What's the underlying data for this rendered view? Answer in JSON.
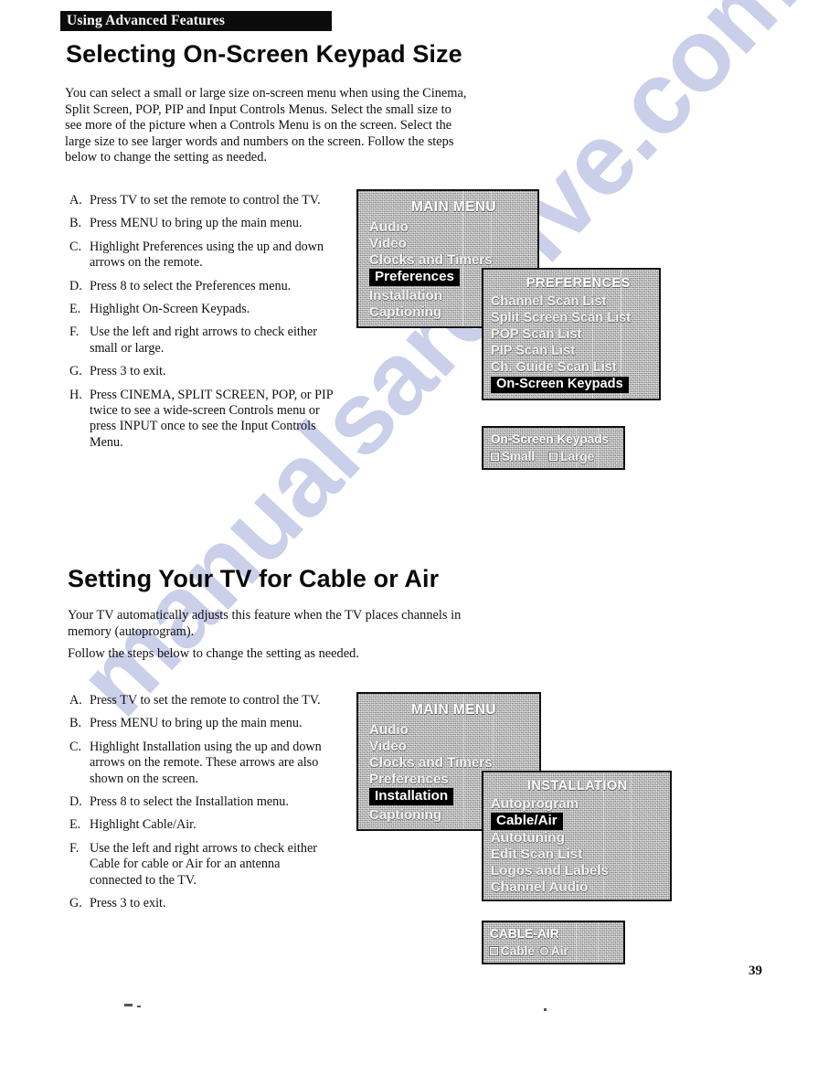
{
  "running_head": "Using Advanced Features",
  "page_number": "39",
  "watermark": "manualsarchive.com",
  "colors": {
    "ink": "#111111",
    "header_bar": "#0b0b0b",
    "highlight_bar": "#000000",
    "menu_screen": "#b8b8b8",
    "watermark": "#b9bfe4"
  },
  "sections": [
    {
      "title": "Selecting On-Screen Keypad Size",
      "intro": "You can select a small or large size on-screen menu when using the Cinema, Split Screen, POP, PIP and Input Controls Menus.  Select the small size to see more of the picture when a Controls Menu is on the screen.  Select the large size to see larger words and numbers on the screen.  Follow the steps below to change the setting as needed.",
      "steps": [
        {
          "letter": "A.",
          "text": "Press TV to set the remote to control the TV."
        },
        {
          "letter": "B.",
          "text": "Press MENU to bring up the main menu."
        },
        {
          "letter": "C.",
          "text": "Highlight Preferences using the up and down arrows on the remote."
        },
        {
          "letter": "D.",
          "text": "Press 8 to select the Preferences menu."
        },
        {
          "letter": "E.",
          "text": "Highlight On-Screen Keypads."
        },
        {
          "letter": "F.",
          "text": "Use the left and right arrows to check either small or large."
        },
        {
          "letter": "G.",
          "text": "Press 3 to exit."
        },
        {
          "letter": "H.",
          "text": "Press CINEMA, SPLIT SCREEN, POP, or PIP twice to see a wide-screen Controls menu or press INPUT once to see the Input Controls Menu."
        }
      ]
    },
    {
      "title": "Setting Your TV for Cable or Air",
      "intro_a": "Your TV automatically adjusts this feature when the TV places channels in memory (autoprogram).",
      "intro_b": "Follow the steps below to change the setting as needed.",
      "steps": [
        {
          "letter": "A.",
          "text": "Press TV to set the remote to control the TV."
        },
        {
          "letter": "B.",
          "text": "Press MENU to bring up the main menu."
        },
        {
          "letter": "C.",
          "text": "Highlight Installation using the up and down arrows on the remote.  These arrows are also shown on the screen."
        },
        {
          "letter": "D.",
          "text": "Press 8 to select the Installation menu."
        },
        {
          "letter": "E.",
          "text": "Highlight Cable/Air."
        },
        {
          "letter": "F.",
          "text": "Use the left and right arrows to check either Cable for cable or Air for an antenna connected to the TV."
        },
        {
          "letter": "G.",
          "text": "Press 3 to exit."
        }
      ]
    }
  ],
  "menus": {
    "main_menu_preferences": {
      "title": "MAIN MENU",
      "items": [
        {
          "label": "Audio",
          "highlighted": false
        },
        {
          "label": "Video",
          "highlighted": false
        },
        {
          "label": "Clocks and Timers",
          "highlighted": false
        },
        {
          "label": "Preferences",
          "highlighted": true
        },
        {
          "label": "Installation",
          "highlighted": false
        },
        {
          "label": "Captioning",
          "highlighted": false
        }
      ]
    },
    "preferences": {
      "title": "PREFERENCES",
      "items": [
        {
          "label": "Channel Scan List",
          "highlighted": false
        },
        {
          "label": "Split Screen Scan List",
          "highlighted": false
        },
        {
          "label": "POP Scan List",
          "highlighted": false
        },
        {
          "label": "PIP Scan List",
          "highlighted": false
        },
        {
          "label": "Ch. Guide Scan List",
          "highlighted": false
        },
        {
          "label": "On-Screen Keypads",
          "highlighted": true
        }
      ]
    },
    "on_screen_keypads_dialog": {
      "title": "On-Screen Keypads",
      "options": [
        {
          "label": "Small",
          "marker": "box"
        },
        {
          "label": "Large",
          "marker": "box"
        }
      ]
    },
    "main_menu_installation": {
      "title": "MAIN MENU",
      "items": [
        {
          "label": "Audio",
          "highlighted": false
        },
        {
          "label": "Video",
          "highlighted": false
        },
        {
          "label": "Clocks and Timers",
          "highlighted": false
        },
        {
          "label": "Preferences",
          "highlighted": false
        },
        {
          "label": "Installation",
          "highlighted": true
        },
        {
          "label": "Captioning",
          "highlighted": false
        }
      ]
    },
    "installation": {
      "title": "INSTALLATION",
      "items": [
        {
          "label": "Autoprogram",
          "highlighted": false
        },
        {
          "label": "Cable/Air",
          "highlighted": true
        },
        {
          "label": "Autotuning",
          "highlighted": false
        },
        {
          "label": "Edit Scan List",
          "highlighted": false
        },
        {
          "label": "Logos and Labels",
          "highlighted": false
        },
        {
          "label": "Channel Audio",
          "highlighted": false
        }
      ]
    },
    "cable_air_dialog": {
      "title": "CABLE-AIR",
      "options": [
        {
          "label": "Cable",
          "marker": "box"
        },
        {
          "label": "Air",
          "marker": "circle"
        }
      ]
    }
  }
}
